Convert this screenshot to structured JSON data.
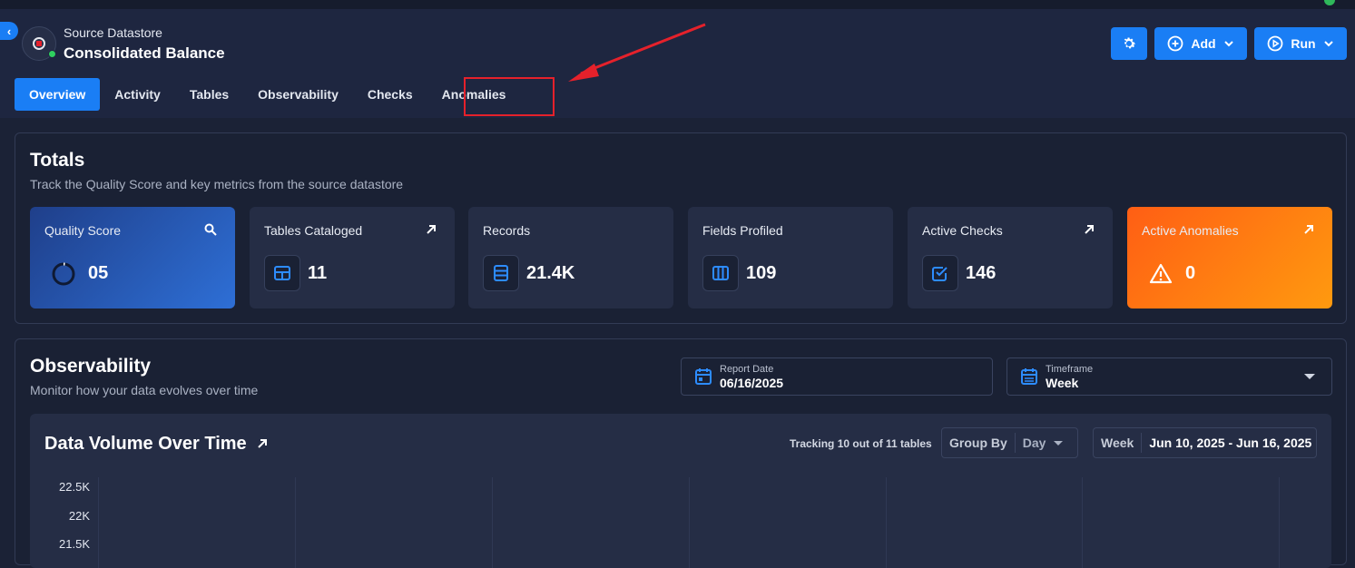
{
  "datastore": {
    "type_label": "Source Datastore",
    "name": "Consolidated Balance",
    "status_color": "#2fd05f"
  },
  "actions": {
    "settings_icon": "gear-icon",
    "add_label": "Add",
    "run_label": "Run"
  },
  "tabs": [
    {
      "label": "Overview",
      "active": true
    },
    {
      "label": "Activity",
      "active": false
    },
    {
      "label": "Tables",
      "active": false
    },
    {
      "label": "Observability",
      "active": false
    },
    {
      "label": "Checks",
      "active": false
    },
    {
      "label": "Anomalies",
      "active": false,
      "highlighted": true
    }
  ],
  "totals": {
    "title": "Totals",
    "subtitle": "Track the Quality Score and key metrics from the source datastore",
    "metrics": [
      {
        "label": "Quality Score",
        "value": "05",
        "corner_icon": "search-icon"
      },
      {
        "label": "Tables Cataloged",
        "value": "11",
        "icon": "table-icon",
        "corner_icon": "arrow-up-right-icon"
      },
      {
        "label": "Records",
        "value": "21.4K",
        "icon": "records-icon"
      },
      {
        "label": "Fields Profiled",
        "value": "109",
        "icon": "columns-icon"
      },
      {
        "label": "Active Checks",
        "value": "146",
        "icon": "check-icon",
        "corner_icon": "arrow-up-right-icon"
      },
      {
        "label": "Active Anomalies",
        "value": "0",
        "icon": "warning-icon",
        "corner_icon": "arrow-up-right-icon"
      }
    ]
  },
  "observability": {
    "title": "Observability",
    "subtitle": "Monitor how your data evolves over time",
    "report_date_label": "Report Date",
    "report_date_value": "06/16/2025",
    "timeframe_label": "Timeframe",
    "timeframe_value": "Week",
    "chart": {
      "title": "Data Volume Over Time",
      "tracking_text": "Tracking 10 out of 11 tables",
      "group_by_label": "Group By",
      "group_by_value": "Day",
      "week_label": "Week",
      "week_range": "Jun 10, 2025 - Jun 16, 2025",
      "y_ticks": [
        "22.5K",
        "22K",
        "21.5K"
      ]
    }
  },
  "colors": {
    "accent": "#1a7ef5",
    "highlight": "#e5212b",
    "anomaly_gradient_start": "#ff5e14",
    "anomaly_gradient_end": "#ff9a0f"
  }
}
